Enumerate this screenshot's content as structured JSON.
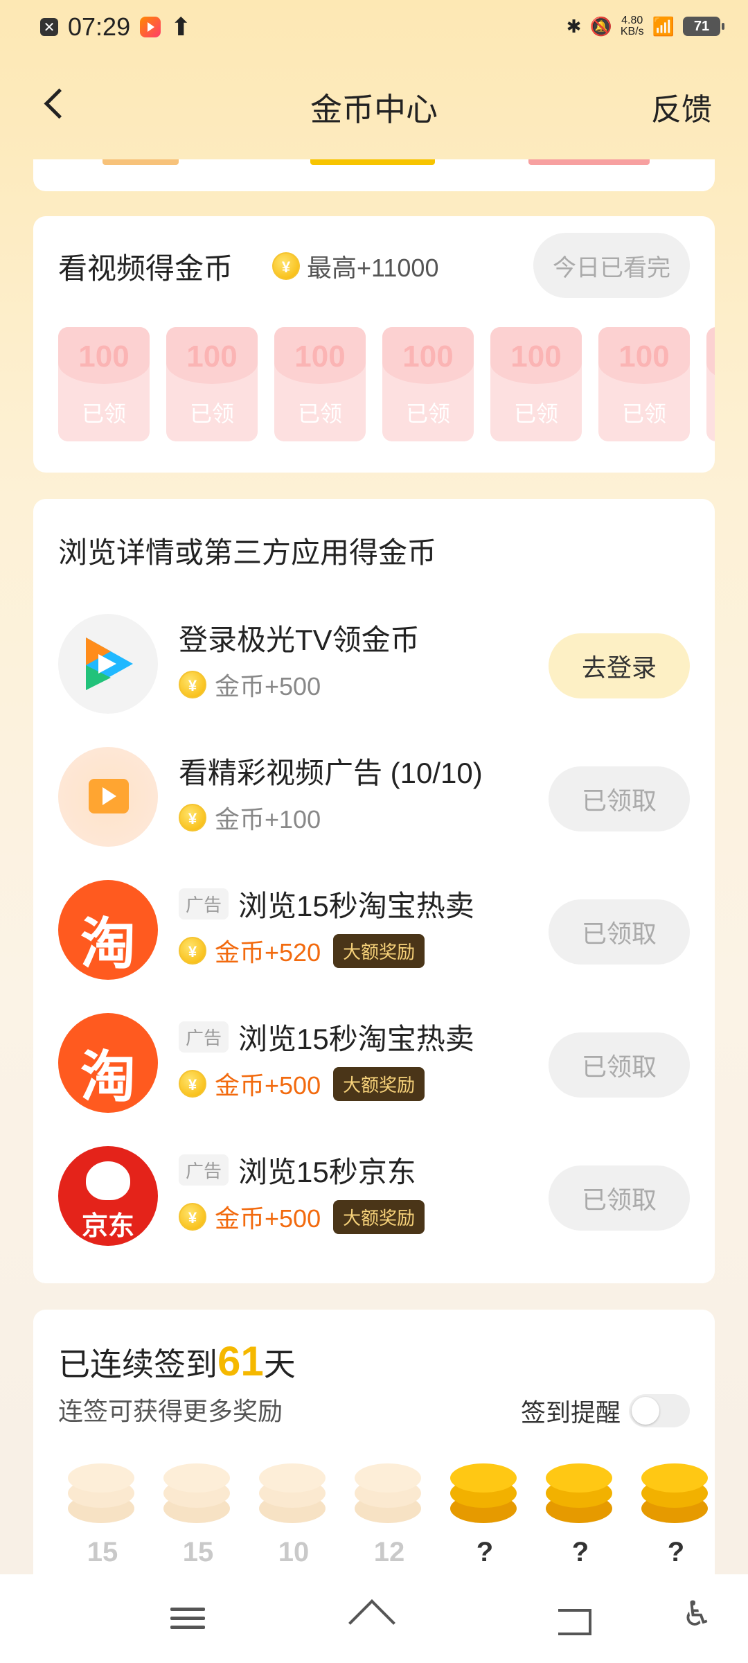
{
  "status_bar": {
    "time": "07:29",
    "net_speed_value": "4.80",
    "net_speed_unit": "KB/s",
    "battery": "71"
  },
  "header": {
    "title": "金币中心",
    "feedback": "反馈"
  },
  "video_card": {
    "title": "看视频得金币",
    "max_reward": "最高+11000",
    "status_button": "今日已看完",
    "envelopes": [
      {
        "amount": "100",
        "label": "已领"
      },
      {
        "amount": "100",
        "label": "已领"
      },
      {
        "amount": "100",
        "label": "已领"
      },
      {
        "amount": "100",
        "label": "已领"
      },
      {
        "amount": "100",
        "label": "已领"
      },
      {
        "amount": "100",
        "label": "已领"
      }
    ]
  },
  "tasks_card": {
    "title": "浏览详情或第三方应用得金币",
    "tasks": [
      {
        "title": "登录极光TV领金币",
        "reward": "金币+500",
        "button": "去登录",
        "icon": "tencent-video-icon"
      },
      {
        "title": "看精彩视频广告 (10/10)",
        "reward": "金币+100",
        "button": "已领取",
        "icon": "video-ad-icon"
      },
      {
        "ad_tag": "广告",
        "title": "浏览15秒淘宝热卖",
        "reward": "金币+520",
        "badge": "大额奖励",
        "button": "已领取",
        "icon": "taobao-icon"
      },
      {
        "ad_tag": "广告",
        "title": "浏览15秒淘宝热卖",
        "reward": "金币+500",
        "badge": "大额奖励",
        "button": "已领取",
        "icon": "taobao-icon"
      },
      {
        "ad_tag": "广告",
        "title": "浏览15秒京东",
        "reward": "金币+500",
        "badge": "大额奖励",
        "button": "已领取",
        "icon": "jd-icon"
      }
    ]
  },
  "sign_card": {
    "title_prefix": "已连续签到",
    "days": "61",
    "title_suffix": "天",
    "subtitle": "连签可获得更多奖励",
    "reminder_label": "签到提醒",
    "reminder_on": false,
    "rewards": [
      "15",
      "15",
      "10",
      "12",
      "?",
      "?",
      "?"
    ]
  },
  "colors": {
    "accent_gold": "#f5b800",
    "reward_orange": "#f26a0e",
    "background": "#fdf1d6"
  }
}
